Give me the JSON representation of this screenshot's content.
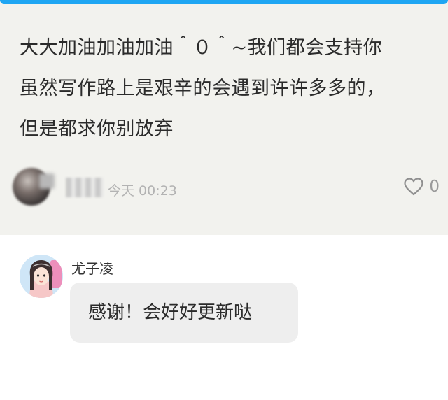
{
  "comment": {
    "lines": [
      "大大加油加油加油＾０＾~我们都会支持你",
      "虽然写作路上是艰辛的会遇到许许多多的，",
      "但是都求你别放弃"
    ],
    "timestamp": "今天 00:23",
    "like_count": "0"
  },
  "reply": {
    "author": "尤子凌",
    "text": "感谢！会好好更新哒"
  },
  "colors": {
    "accent": "#1fa6f3",
    "card_background": "#f2f2ee",
    "bubble_background": "#eeeeee"
  },
  "icons": {
    "like": "heart-outline-icon"
  }
}
